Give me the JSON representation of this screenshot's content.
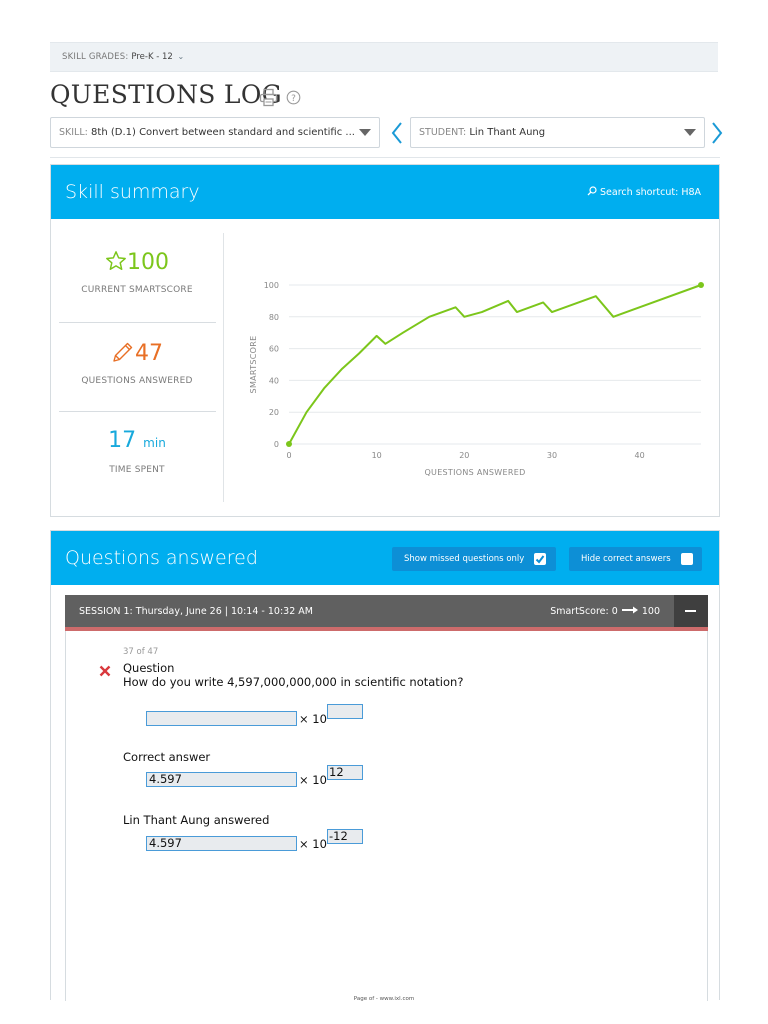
{
  "grade_filter": {
    "label": "SKILL GRADES:",
    "value": "Pre-K - 12"
  },
  "page_title": "QUESTIONS LOG",
  "skill_dropdown": {
    "label": "SKILL:",
    "value": "8th (D.1)  Convert between standard and scientific ..."
  },
  "student_dropdown": {
    "label": "STUDENT:",
    "value": "Lin Thant Aung"
  },
  "summary": {
    "title": "Skill summary",
    "search_shortcut_label": "Search shortcut:",
    "search_shortcut_code": "H8A",
    "smartscore": {
      "value": "100",
      "caption": "CURRENT SMARTSCORE"
    },
    "questions": {
      "value": "47",
      "caption": "QUESTIONS ANSWERED"
    },
    "time": {
      "value": "17",
      "unit": "min",
      "caption": "TIME SPENT"
    }
  },
  "colors": {
    "header_blue": "#00aeef",
    "green": "#7cc61b",
    "orange": "#e86f25",
    "teal": "#17a9dc",
    "session_gray": "#606060",
    "missed_red": "#cd6b6b"
  },
  "chart_data": {
    "type": "line",
    "title": "",
    "xlabel": "QUESTIONS ANSWERED",
    "ylabel": "SMARTSCORE",
    "xlim": [
      0,
      47
    ],
    "ylim": [
      0,
      100
    ],
    "x_ticks": [
      "0",
      "10",
      "20",
      "30",
      "40"
    ],
    "y_ticks": [
      "0",
      "20",
      "40",
      "60",
      "80",
      "100"
    ],
    "grid": "horizontal",
    "series": [
      {
        "x": [
          0,
          2,
          4,
          6,
          8,
          10,
          11,
          13,
          16,
          19,
          20,
          22,
          25,
          26,
          29,
          30,
          35,
          37,
          47
        ],
        "y": [
          0,
          20,
          35,
          47,
          57,
          68,
          63,
          70,
          80,
          86,
          80,
          83,
          90,
          83,
          89,
          83,
          93,
          80,
          100
        ]
      }
    ]
  },
  "questions_answered": {
    "title": "Questions answered",
    "toggle_missed": "Show missed questions only",
    "toggle_hide": "Hide correct answers"
  },
  "session": {
    "label": "SESSION 1: Thursday, June 26 | 10:14 - 10:32 AM",
    "smartscore_label": "SmartScore: 0",
    "smartscore_to": "100"
  },
  "question": {
    "counter": "37 of 47",
    "heading": "Question",
    "prompt": "How do you write 4,597,000,000,000 in scientific notation?",
    "times_ten": "× 10",
    "blank_mantissa": "",
    "blank_exponent": "",
    "correct_label": "Correct answer",
    "correct_mantissa": "4.597",
    "correct_exponent": "12",
    "student_label": "Lin Thant Aung  answered",
    "student_mantissa": "4.597",
    "student_exponent": "-12"
  },
  "footer": "Page of - www.ixl.com"
}
